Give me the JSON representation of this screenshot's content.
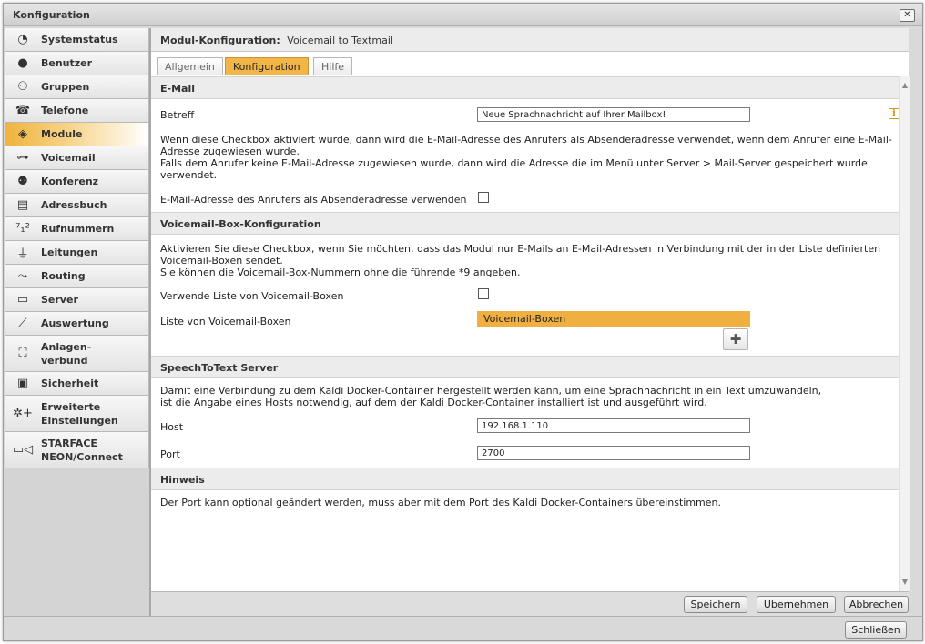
{
  "window": {
    "title": "Konfiguration",
    "close_label": "✕"
  },
  "sidebar": {
    "items": [
      {
        "label": "Systemstatus",
        "icon": "◔"
      },
      {
        "label": "Benutzer",
        "icon": "●"
      },
      {
        "label": "Gruppen",
        "icon": "⚇"
      },
      {
        "label": "Telefone",
        "icon": "☎"
      },
      {
        "label": "Module",
        "icon": "◈"
      },
      {
        "label": "Voicemail",
        "icon": "⊶"
      },
      {
        "label": "Konferenz",
        "icon": "⚉"
      },
      {
        "label": "Adressbuch",
        "icon": "▤"
      },
      {
        "label": "Rufnummern",
        "icon": "⁷₁²"
      },
      {
        "label": "Leitungen",
        "icon": "⏚"
      },
      {
        "label": "Routing",
        "icon": "⤳"
      },
      {
        "label": "Server",
        "icon": "▭"
      },
      {
        "label": "Auswertung",
        "icon": "⟋"
      },
      {
        "label": "Anlagen-\nverbund",
        "icon": "⛶"
      },
      {
        "label": "Sicherheit",
        "icon": "▣"
      },
      {
        "label": "Erweiterte\nEinstellungen",
        "icon": "✲+"
      },
      {
        "label": "STARFACE\nNEON/Connect",
        "icon": "▭◁"
      }
    ]
  },
  "header": {
    "label": "Modul-Konfiguration:",
    "value": "Voicemail to Textmail"
  },
  "tabs": [
    {
      "label": "Allgemein"
    },
    {
      "label": "Konfiguration"
    },
    {
      "label": "Hilfe"
    }
  ],
  "email": {
    "heading": "E-Mail",
    "subject_label": "Betreff",
    "subject_value": "Neue Sprachnachricht auf Ihrer Mailbox!",
    "info_icon": "i",
    "desc1": "Wenn diese Checkbox aktiviert wurde, dann wird die E-Mail-Adresse des Anrufers als Absenderadresse verwendet, wenn dem Anrufer eine E-Mail-",
    "desc2": "Adresse zugewiesen wurde.",
    "desc3": "Falls dem Anrufer keine E-Mail-Adresse zugewiesen wurde, dann wird die Adresse die im Menü unter Server > Mail-Server gespeichert wurde",
    "desc4": "verwendet.",
    "sender_label": "E-Mail-Adresse des Anrufers als Absenderadresse verwenden"
  },
  "voicemail_box": {
    "heading": "Voicemail-Box-Konfiguration",
    "desc1": "Aktivieren Sie diese Checkbox, wenn Sie möchten, dass das Modul nur E-Mails an E-Mail-Adressen in Verbindung mit der in der Liste definierten",
    "desc2": "Voicemail-Boxen sendet.",
    "desc3": "Sie können die Voicemail-Box-Nummern ohne die führende *9 angeben.",
    "use_list_label": "Verwende Liste von Voicemail-Boxen",
    "list_label": "Liste von Voicemail-Boxen",
    "list_header": "Voicemail-Boxen",
    "add_icon": "✚"
  },
  "speech": {
    "heading": "SpeechToText Server",
    "desc1": "Damit eine Verbindung zu dem Kaldi Docker-Container hergestellt werden kann, um eine Sprachnachricht in ein Text umzuwandeln,",
    "desc2": "ist die Angabe eines Hosts notwendig, auf dem der Kaldi Docker-Container installiert ist und ausgeführt wird.",
    "host_label": "Host",
    "host_value": "192.168.1.110",
    "port_label": "Port",
    "port_value": "2700"
  },
  "hint": {
    "heading": "Hinweis",
    "text": "Der Port kann optional geändert werden, muss aber mit dem Port des Kaldi Docker-Containers übereinstimmen."
  },
  "footer": {
    "save": "Speichern",
    "apply": "Übernehmen",
    "cancel": "Abbrechen"
  },
  "bottom": {
    "close": "Schließen"
  },
  "colors": {
    "accent": "#f0b040",
    "active_tab": "#f2b548"
  }
}
